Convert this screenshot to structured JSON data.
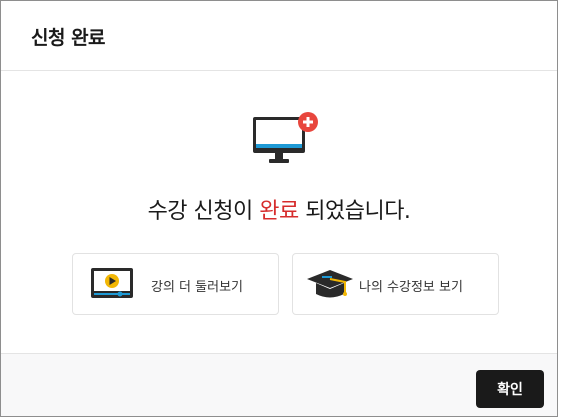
{
  "modal": {
    "title": "신청 완료",
    "message_prefix": "수강 신청이 ",
    "message_accent": "완료",
    "message_suffix": " 되었습니다.",
    "cards": [
      {
        "label": "강의 더 둘러보기",
        "icon": "video-player-icon"
      },
      {
        "label": "나의 수강정보 보기",
        "icon": "graduation-cap-icon"
      }
    ],
    "confirm_label": "확인"
  },
  "colors": {
    "accent": "#d62c2c",
    "button_bg": "#1a1a1a",
    "icon_blue": "#1e9ad6"
  }
}
